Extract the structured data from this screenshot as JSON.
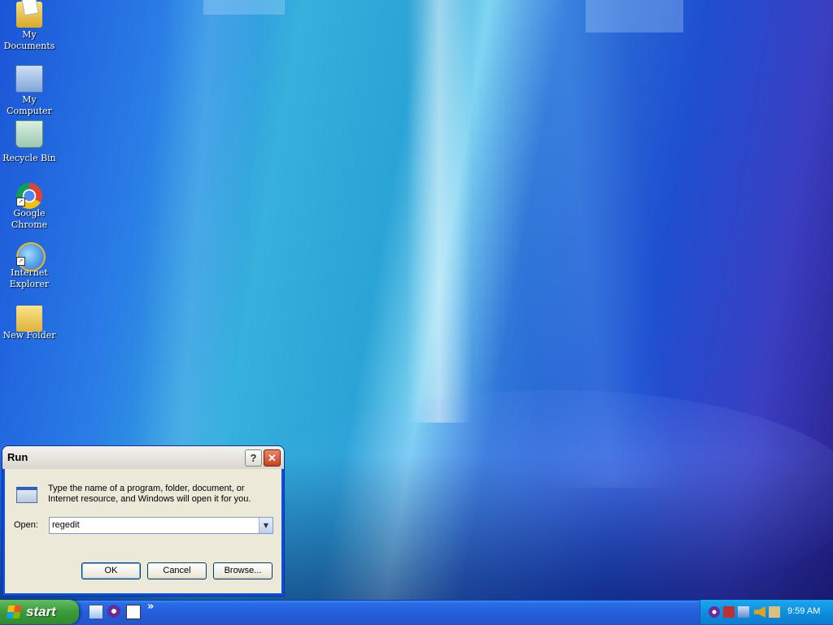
{
  "desktop": {
    "icons": [
      {
        "label_line1": "My",
        "label_line2": "Documents"
      },
      {
        "label_line1": "My Computer",
        "label_line2": ""
      },
      {
        "label_line1": "Recycle Bin",
        "label_line2": ""
      },
      {
        "label_line1": "Google",
        "label_line2": "Chrome"
      },
      {
        "label_line1": "Internet",
        "label_line2": "Explorer"
      },
      {
        "label_line1": "New Folder",
        "label_line2": ""
      }
    ]
  },
  "run_dialog": {
    "title": "Run",
    "help_glyph": "?",
    "close_glyph": "✕",
    "prompt_line1": "Type the name of a program, folder, document, or",
    "prompt_line2": "Internet resource, and Windows will open it for you.",
    "open_label": "Open:",
    "open_value": "regedit",
    "ok_label": "OK",
    "cancel_label": "Cancel",
    "browse_label": "Browse..."
  },
  "taskbar": {
    "start_label": "start",
    "more_glyph": "»",
    "clock": "9:59 AM"
  }
}
